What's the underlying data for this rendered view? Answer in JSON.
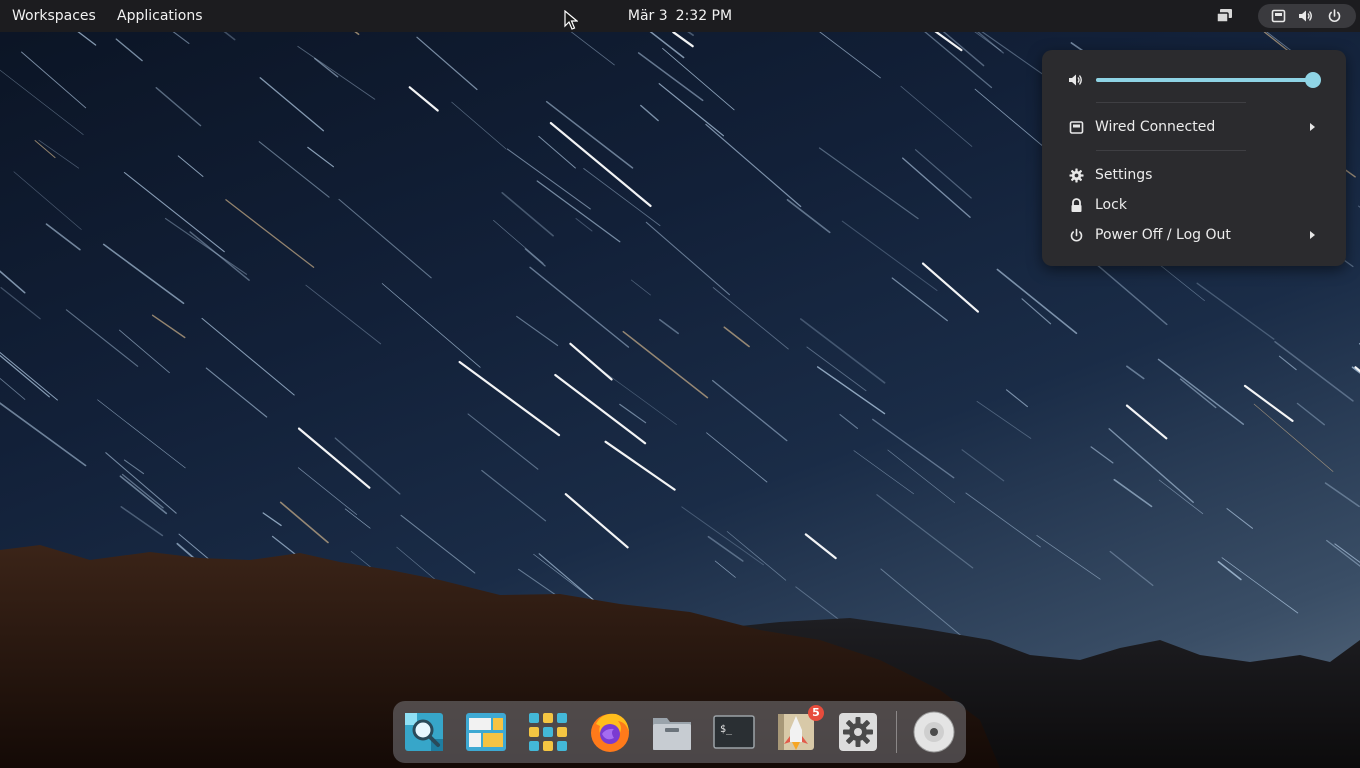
{
  "topbar": {
    "workspaces_label": "Workspaces",
    "applications_label": "Applications",
    "date": "Mär 3",
    "time": "2:32 PM"
  },
  "system_menu": {
    "volume_percent": 97,
    "items": {
      "network": "Wired Connected",
      "settings": "Settings",
      "lock": "Lock",
      "power": "Power Off / Log Out"
    }
  },
  "dock": {
    "apps": [
      "search-icon",
      "windows-overview-icon",
      "app-grid-icon",
      "firefox-icon",
      "files-icon",
      "terminal-icon",
      "app-store-icon",
      "settings-icon",
      "optical-disc-icon"
    ],
    "store_badge": "5"
  },
  "colors": {
    "accent": "#8fd4e5",
    "topbar_bg": "#1c1c1f",
    "panel_bg": "#2b2b2e",
    "badge": "#e74c3c"
  }
}
